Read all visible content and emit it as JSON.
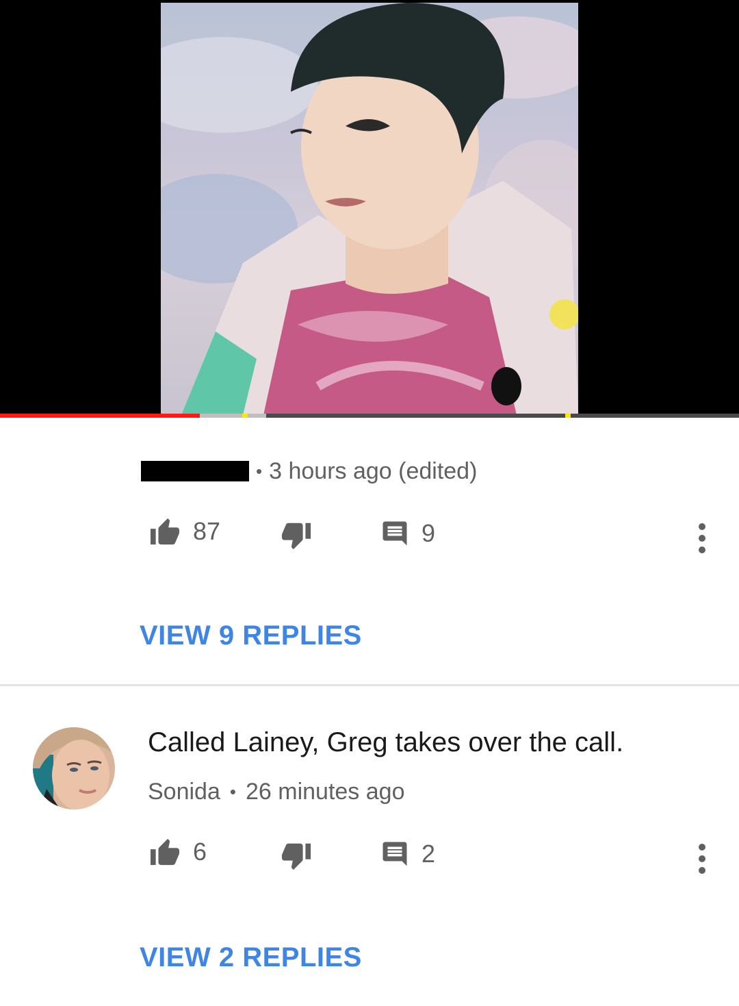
{
  "player": {
    "progress_fraction": 0.27,
    "buffered_fraction": 0.36,
    "colors": {
      "played": "#ff1a1a",
      "buffered": "#bfbfbf",
      "track": "#4a4a4a",
      "ad_marker": "#ffe600"
    }
  },
  "comments": [
    {
      "author": "",
      "author_redacted": true,
      "separator": "•",
      "time": "3 hours ago (edited)",
      "likes": "87",
      "replies_count": "9",
      "view_replies_label": "VIEW 9 REPLIES"
    },
    {
      "text": "Called Lainey, Greg takes over the call.",
      "author": "Sonida",
      "separator": "•",
      "time": "26 minutes ago",
      "likes": "6",
      "replies_count": "2",
      "view_replies_label": "VIEW 2 REPLIES"
    }
  ],
  "icons": {
    "like": "thumbs-up-icon",
    "dislike": "thumbs-down-icon",
    "reply": "comment-icon",
    "more": "more-vert-icon"
  },
  "colors": {
    "link": "#3e85e6",
    "secondary_text": "#606060",
    "icon": "#606060"
  }
}
